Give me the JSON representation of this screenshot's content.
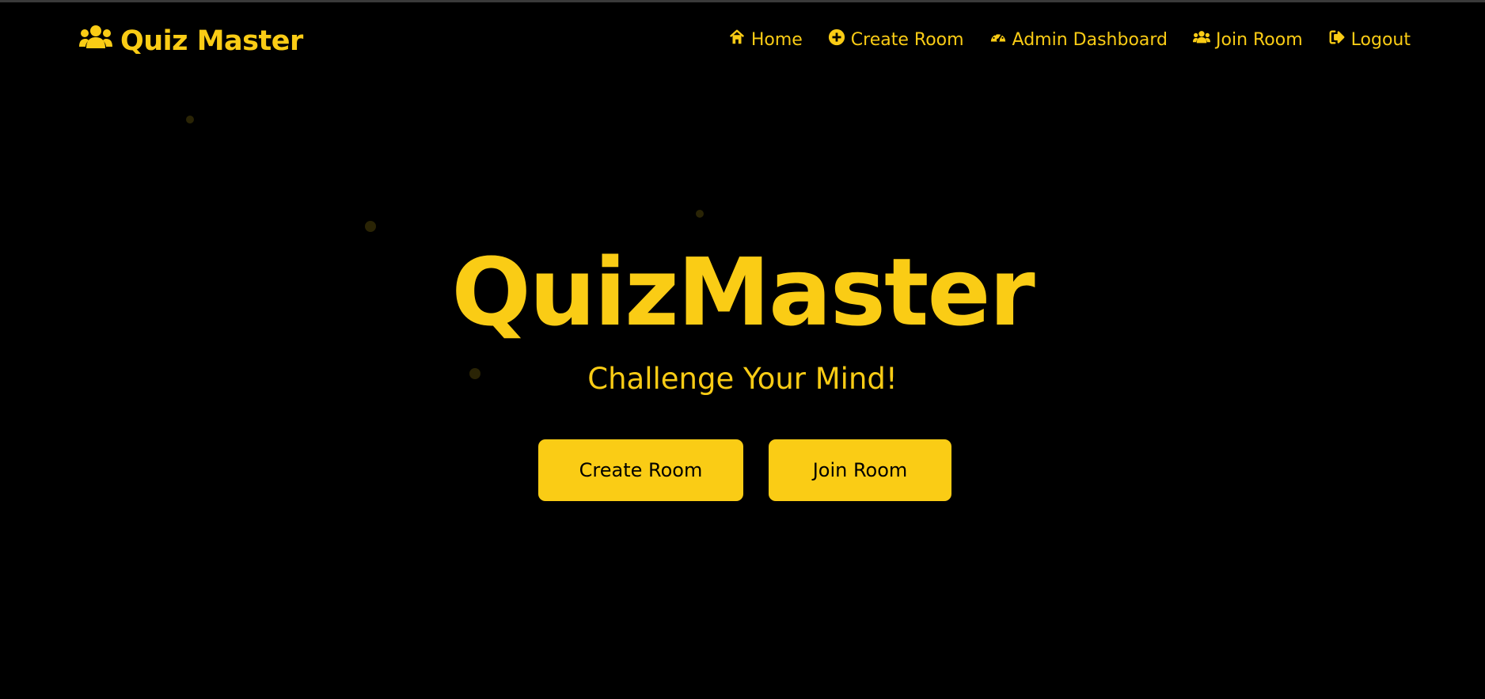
{
  "theme": {
    "accent": "#facc15",
    "background": "#000000"
  },
  "navbar": {
    "brand": {
      "icon": "users-icon",
      "label": "Quiz Master"
    },
    "links": [
      {
        "icon": "home-icon",
        "label": "Home"
      },
      {
        "icon": "plus-circle-icon",
        "label": "Create Room"
      },
      {
        "icon": "dashboard-icon",
        "label": "Admin Dashboard"
      },
      {
        "icon": "users-icon",
        "label": "Join Room"
      },
      {
        "icon": "logout-icon",
        "label": "Logout"
      }
    ]
  },
  "hero": {
    "title": "QuizMaster",
    "subtitle": "Challenge Your Mind!",
    "buttons": {
      "create_label": "Create Room",
      "join_label": "Join Room"
    }
  }
}
